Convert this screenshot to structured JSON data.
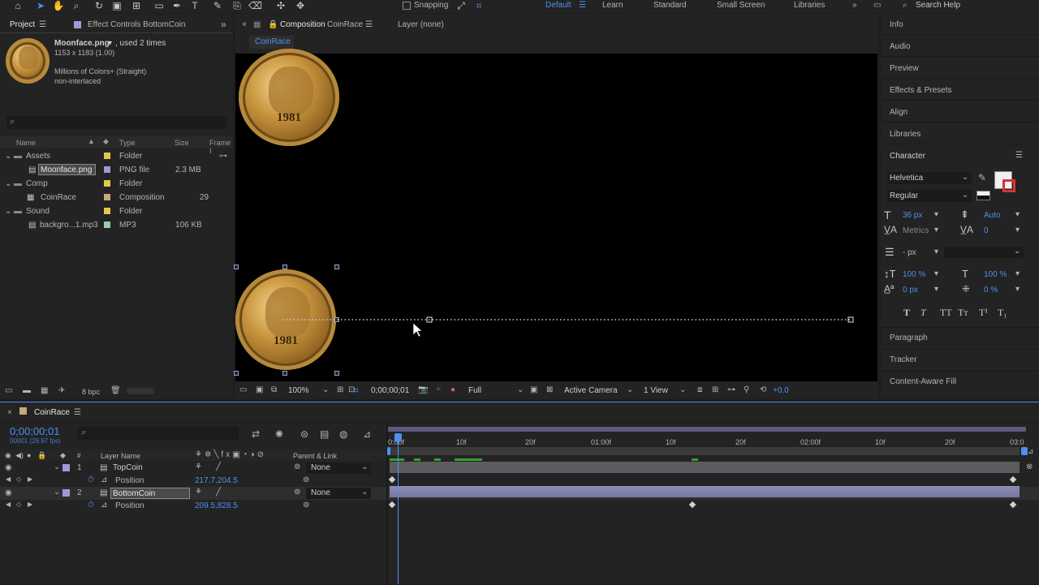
{
  "toolbar": {
    "snapping_label": "Snapping",
    "workspaces": [
      "Default",
      "Learn",
      "Standard",
      "Small Screen",
      "Libraries"
    ],
    "search_help": "Search Help"
  },
  "project_panel": {
    "tab_project": "Project",
    "tab_effect_controls": "Effect Controls BottomCoin",
    "asset_name": "Moonface.png",
    "asset_used": ", used 2 times",
    "asset_dims": "1153 x 1183 (1.00)",
    "asset_colors": "Millions of Colors+ (Straight)",
    "asset_interlace": "non-interlaced",
    "columns": {
      "name": "Name",
      "type": "Type",
      "size": "Size",
      "frame": "Frame I"
    },
    "items": [
      {
        "name": "Assets",
        "type": "Folder",
        "size": "",
        "frame": "",
        "swatch": "#e2c84a"
      },
      {
        "name": "Moonface.png",
        "type": "PNG file",
        "size": "2.3 MB",
        "frame": "",
        "swatch": "#9b9bd8"
      },
      {
        "name": "Comp",
        "type": "Folder",
        "size": "",
        "frame": "",
        "swatch": "#e2c84a"
      },
      {
        "name": "CoinRace",
        "type": "Composition",
        "size": "",
        "frame": "29",
        "swatch": "#c8a878"
      },
      {
        "name": "Sound",
        "type": "Folder",
        "size": "",
        "frame": "",
        "swatch": "#e2c84a"
      },
      {
        "name": "backgro...1.mp3",
        "type": "MP3",
        "size": "106 KB",
        "frame": "",
        "swatch": "#9ecba8"
      }
    ],
    "bpc": "8 bpc"
  },
  "viewer": {
    "tab_composition": "Composition",
    "tab_composition_name": "CoinRace",
    "tab_layer": "Layer (none)",
    "comp_crumb": "CoinRace",
    "coin_year": "1981",
    "zoom": "100%",
    "timecode": "0;00;00;01",
    "resolution": "Full",
    "camera": "Active Camera",
    "views": "1 View",
    "exposure": "+0.0"
  },
  "right_panel": {
    "items": [
      "Info",
      "Audio",
      "Preview",
      "Effects & Presets",
      "Align",
      "Libraries"
    ],
    "character_title": "Character",
    "font": "Helvetica",
    "style": "Regular",
    "size": "36 px",
    "leading": "Auto",
    "kerning": "Metrics",
    "tracking": "0",
    "stroke": "- px",
    "vscale": "100 %",
    "hscale": "100 %",
    "baseline": "0 px",
    "tsume": "0 %",
    "format_buttons": [
      "T",
      "T",
      "TT",
      "Tт",
      "T¹",
      "T₁"
    ],
    "after_items": [
      "Paragraph",
      "Tracker",
      "Content-Aware Fill"
    ]
  },
  "timeline": {
    "comp_name": "CoinRace",
    "timecode": "0;00;00;01",
    "fps": "00001 (29.97 fps)",
    "col_hash": "#",
    "col_layer_name": "Layer Name",
    "col_parent": "Parent & Link",
    "ruler": [
      "0:00f",
      "10f",
      "20f",
      "01:00f",
      "10f",
      "20f",
      "02:00f",
      "10f",
      "20f",
      "03:0"
    ],
    "layers": [
      {
        "index": "1",
        "name": "TopCoin",
        "parent": "None",
        "prop": "Position",
        "value": "217.7,204.5"
      },
      {
        "index": "2",
        "name": "BottomCoin",
        "parent": "None",
        "prop": "Position",
        "value": "209.5,828.5"
      }
    ]
  },
  "colors": {
    "accent": "#4d90f0",
    "layer_label": "#9b9bd8",
    "panel_bg": "#232323"
  }
}
